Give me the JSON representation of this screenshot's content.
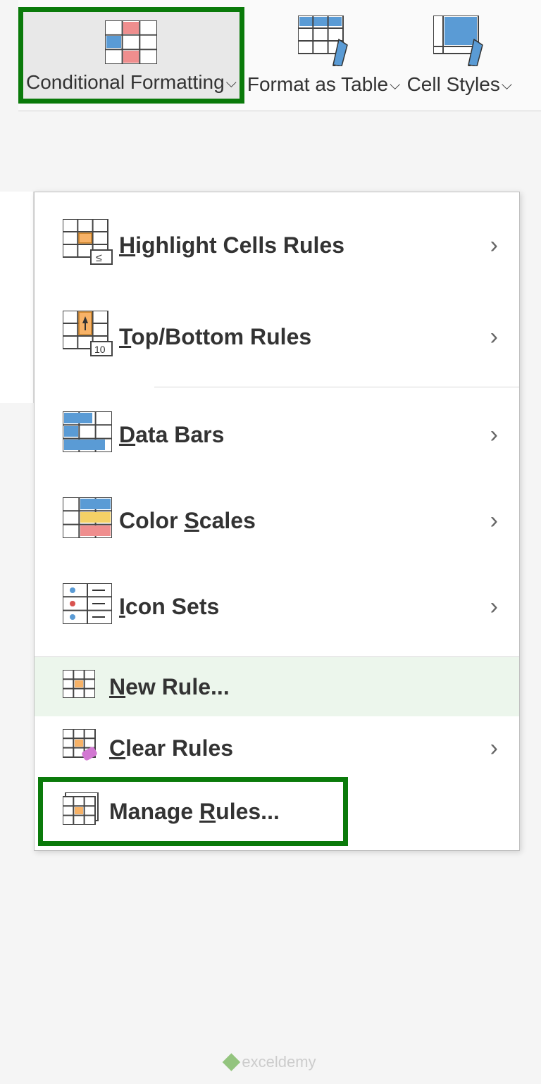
{
  "ribbon": {
    "conditional_formatting": "Conditional Formatting",
    "format_as_table": "Format as Table",
    "cell_styles": "Cell Styles"
  },
  "menu": {
    "highlight_cells_rules": "Highlight Cells Rules",
    "top_bottom_rules": "Top/Bottom Rules",
    "data_bars": "Data Bars",
    "color_scales": "Color Scales",
    "icon_sets": "Icon Sets",
    "new_rule": "New Rule...",
    "clear_rules": "Clear Rules",
    "manage_rules": "Manage Rules..."
  },
  "watermark": "exceldemy"
}
